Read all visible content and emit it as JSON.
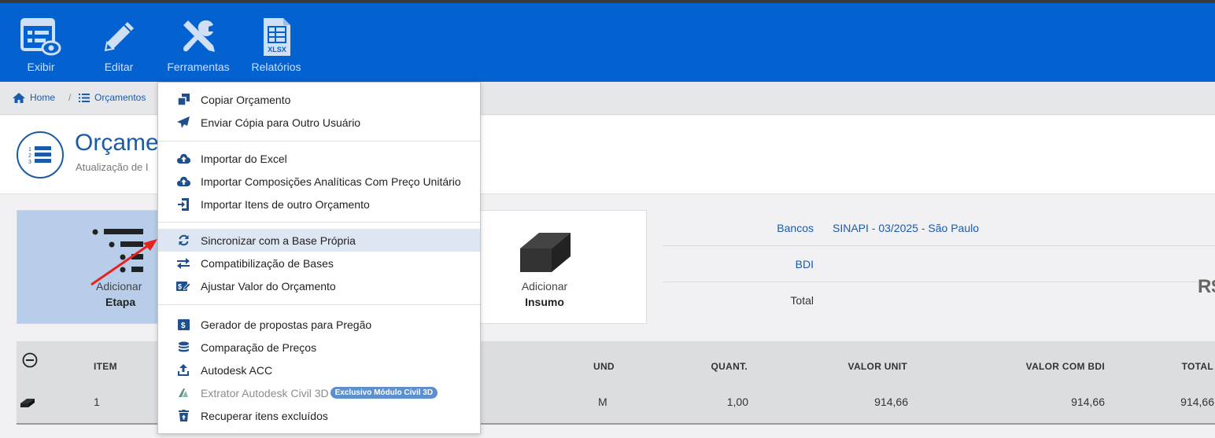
{
  "toolbar": {
    "items": [
      {
        "label": "Exibir",
        "icon": "view-icon"
      },
      {
        "label": "Editar",
        "icon": "pencil-icon"
      },
      {
        "label": "Ferramentas",
        "icon": "tools-icon"
      },
      {
        "label": "Relatórios",
        "icon": "xlsx-icon",
        "icon_text": "XLSX"
      }
    ]
  },
  "breadcrumb": {
    "home": "Home",
    "separator": "/",
    "current": "Orçamentos"
  },
  "header": {
    "title": "Orçame",
    "subtitle": "Atualização de I"
  },
  "cards": {
    "etapa": {
      "line1": "Adicionar",
      "line2": "Etapa"
    },
    "insumo": {
      "line1": "Adicionar",
      "line2": "Insumo"
    }
  },
  "info": {
    "bancos_label": "Bancos",
    "bancos_value": "SINAPI - 03/2025 - São Paulo",
    "bdi_label": "BDI",
    "total_label": "Total",
    "total_value": "R$"
  },
  "table": {
    "headers": {
      "item": "ITEM",
      "und": "UND",
      "quant": "QUANT.",
      "valor_unit": "VALOR UNIT",
      "valor_bdi": "VALOR COM BDI",
      "total": "TOTAL"
    },
    "rows": [
      {
        "item": "1",
        "und": "M",
        "quant": "1,00",
        "valor_unit": "914,66",
        "valor_bdi": "914,66",
        "total": "914,66"
      }
    ]
  },
  "menu": {
    "items": [
      {
        "label": "Copiar Orçamento",
        "icon": "copy-icon"
      },
      {
        "label": "Enviar Cópia para Outro Usuário",
        "icon": "send-icon"
      },
      {
        "label": "Importar do Excel",
        "icon": "cloud-upload-icon"
      },
      {
        "label": "Importar Composições Analíticas Com Preço Unitário",
        "icon": "cloud-upload-icon"
      },
      {
        "label": "Importar Itens de outro Orçamento",
        "icon": "import-icon"
      },
      {
        "label": "Sincronizar com a Base Própria",
        "icon": "sync-icon"
      },
      {
        "label": "Compatibilização de Bases",
        "icon": "swap-icon"
      },
      {
        "label": "Ajustar Valor do Orçamento",
        "icon": "adjust-value-icon"
      },
      {
        "label": "Gerador de propostas para Pregão",
        "icon": "proposal-icon"
      },
      {
        "label": "Comparação de Preços",
        "icon": "coins-icon"
      },
      {
        "label": "Autodesk ACC",
        "icon": "upload-icon"
      },
      {
        "label": "Extrator Autodesk Civil 3D",
        "icon": "autodesk-icon",
        "badge": "Exclusivo Módulo Civil 3D"
      },
      {
        "label": "Recuperar itens excluídos",
        "icon": "trash-restore-icon"
      }
    ]
  },
  "colors": {
    "toolbar": "#0361d0",
    "accent": "#1b5aa6",
    "highlight": "#dde6f3",
    "annotation_arrow": "#e8231c"
  }
}
